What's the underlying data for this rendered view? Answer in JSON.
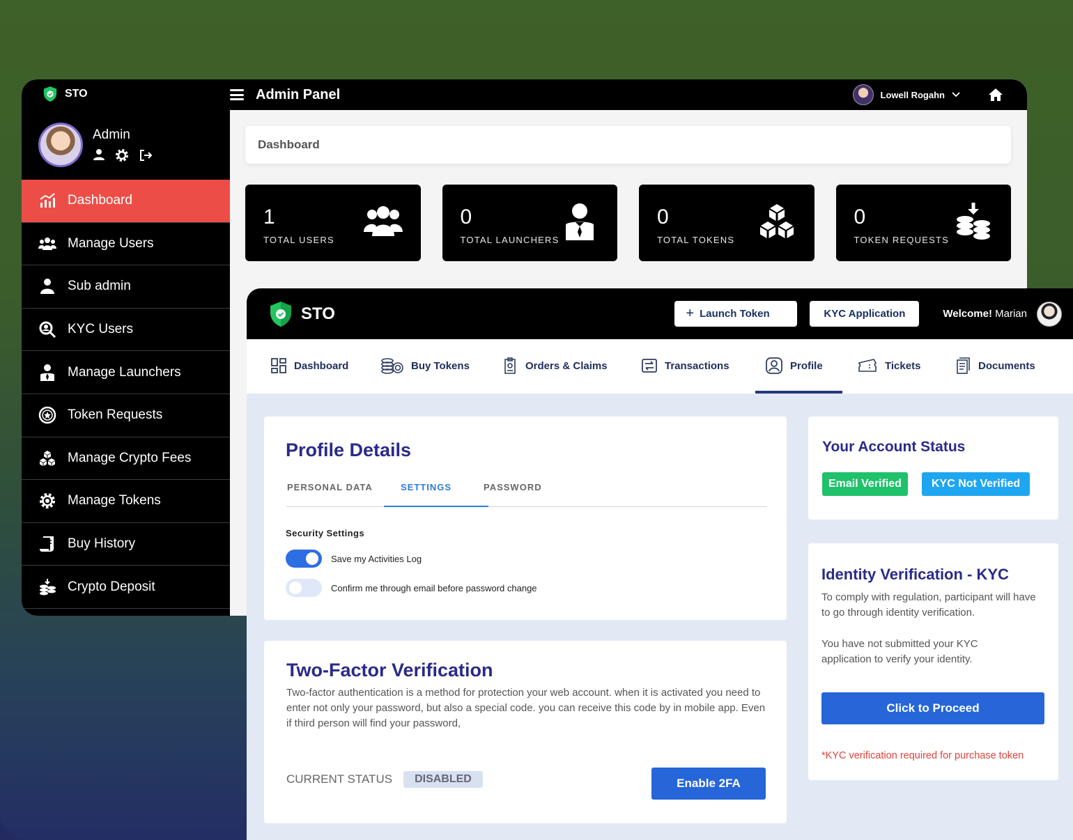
{
  "admin": {
    "brand": "STO",
    "user_name": "Admin",
    "panel_title": "Admin Panel",
    "top_user": "Lowell Rogahn",
    "breadcrumb": "Dashboard",
    "menu": [
      {
        "label": "Dashboard",
        "icon": "chart-icon",
        "active": true
      },
      {
        "label": "Manage Users",
        "icon": "users-icon",
        "active": false
      },
      {
        "label": "Sub admin",
        "icon": "user-icon",
        "active": false
      },
      {
        "label": "KYC Users",
        "icon": "user-search-icon",
        "active": false
      },
      {
        "label": "Manage Launchers",
        "icon": "user-tie-icon",
        "active": false
      },
      {
        "label": "Token Requests",
        "icon": "star-circle-icon",
        "active": false
      },
      {
        "label": "Manage Crypto Fees",
        "icon": "cubes-icon",
        "active": false
      },
      {
        "label": "Manage Tokens",
        "icon": "gear-icon",
        "active": false
      },
      {
        "label": "Buy History",
        "icon": "receipt-icon",
        "active": false
      },
      {
        "label": "Crypto Deposit",
        "icon": "coins-icon",
        "active": false
      }
    ],
    "stats": [
      {
        "value": "1",
        "label": "TOTAL USERS",
        "icon": "users-icon"
      },
      {
        "value": "0",
        "label": "TOTAL LAUNCHERS",
        "icon": "user-tie-icon"
      },
      {
        "value": "0",
        "label": "TOTAL TOKENS",
        "icon": "cubes-icon"
      },
      {
        "value": "0",
        "label": "TOKEN REQUESTS",
        "icon": "coins-download-icon"
      }
    ]
  },
  "user": {
    "brand": "STO",
    "launch_token": "Launch Token",
    "kyc_application": "KYC Application",
    "welcome_prefix": "Welcome!",
    "welcome_name": "Marian",
    "nav": [
      {
        "label": "Dashboard",
        "icon": "grid-icon"
      },
      {
        "label": "Buy Tokens",
        "icon": "coins-icon"
      },
      {
        "label": "Orders & Claims",
        "icon": "document-icon"
      },
      {
        "label": "Transactions",
        "icon": "exchange-icon"
      },
      {
        "label": "Profile",
        "icon": "profile-icon",
        "active": true
      },
      {
        "label": "Tickets",
        "icon": "ticket-icon"
      },
      {
        "label": "Documents",
        "icon": "documents-icon"
      }
    ],
    "profile": {
      "title": "Profile Details",
      "tabs": [
        "PERSONAL DATA",
        "SETTINGS",
        "PASSWORD"
      ],
      "active_tab": "SETTINGS",
      "section_title": "Security Settings",
      "toggles": [
        {
          "label": "Save my Activities Log",
          "on": true
        },
        {
          "label": "Confirm me through email before password change",
          "on": false
        }
      ]
    },
    "twofa": {
      "title": "Two-Factor Verification",
      "description": "Two-factor authentication is a method for protection your web account. when it is activated you need to enter not only your password, but also a special code. you can receive this code by in mobile app. Even if third person will find your password,",
      "status_label": "CURRENT STATUS",
      "status_value": "DISABLED",
      "button": "Enable 2FA"
    },
    "account_status": {
      "title": "Your Account Status",
      "email_badge": "Email Verified",
      "kyc_badge": "KYC Not Verified"
    },
    "kyc": {
      "title": "Identity Verification - KYC",
      "text1": "To comply with regulation, participant will have to go through identity verification.",
      "text2": "You have not submitted your KYC application to verify your identity.",
      "button": "Click to Proceed",
      "note": "*KYC verification required for purchase token"
    }
  },
  "colors": {
    "accent_red": "#ec4e47",
    "primary_blue": "#2666d8",
    "green_badge": "#22c55e",
    "cyan_badge": "#1fa6f0",
    "title_navy": "#2a2a8a"
  }
}
